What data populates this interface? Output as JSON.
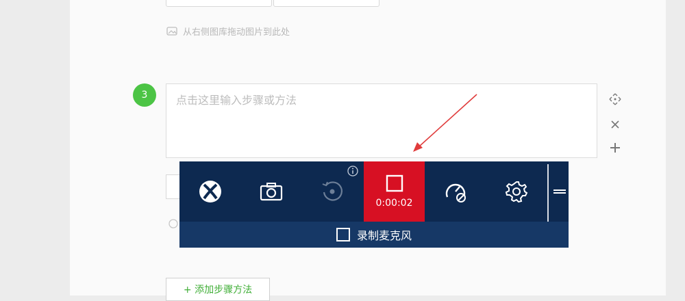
{
  "editor": {
    "upload_hint": "从右侧图库拖动图片到此处",
    "step_number": "3",
    "step_placeholder": "点击这里输入步骤或方法",
    "add_step_label": "+ 添加步骤方法"
  },
  "gamebar": {
    "timer": "0:00:02",
    "mic_label": "录制麦克风",
    "mic_checked": false,
    "buttons": [
      "xbox-icon",
      "camera-icon",
      "record-last-icon",
      "stop-record-icon",
      "performance-icon",
      "settings-icon"
    ]
  },
  "colors": {
    "gamebar_bg": "#0d2950",
    "gamebar_bottom": "#163866",
    "record_red": "#d71023",
    "step_green": "#4cc445",
    "arrow_red": "#e03c3c"
  }
}
